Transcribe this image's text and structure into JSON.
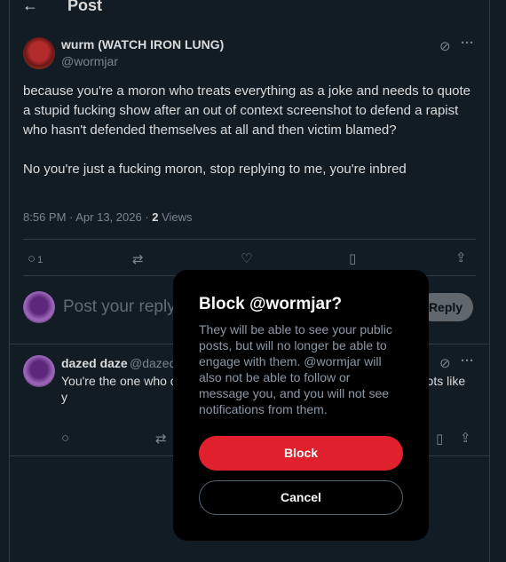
{
  "header": {
    "back_icon": "←",
    "title": "Post"
  },
  "post": {
    "author": "wurm (WATCH IRON LUNG)",
    "handle": "@wormjar",
    "paragraphs": [
      "because you're a moron who treats everything as a joke and needs to quote a stupid fucking show after an out of context screenshot to defend a rapist who hasn't defended themselves at all and then victim blamed?",
      "No you're just a fucking moron, stop replying to me, you're inbred"
    ],
    "timestamp": "8:56 PM · Apr 13, 2026 · ",
    "views_count": "2",
    "views_label": " Views",
    "reply_count": "1"
  },
  "composer": {
    "placeholder": "Post your reply",
    "reply_label": "Reply"
  },
  "reply_post": {
    "author": "dazed daze",
    "handle": "@dazed",
    "text": "You're the one who c                                      e under one post, which no o                                   elf-confident idiots like y"
  },
  "modal": {
    "title": "Block @wormjar?",
    "description": "They will be able to see your public posts, but will no longer be able to engage with them. @wormjar will also not be able to follow or message you, and you will not see notifications from them.",
    "block_label": "Block",
    "cancel_label": "Cancel"
  },
  "colors": {
    "background": "#15202b",
    "block_button": "#e0202c",
    "modal": "#000000"
  }
}
